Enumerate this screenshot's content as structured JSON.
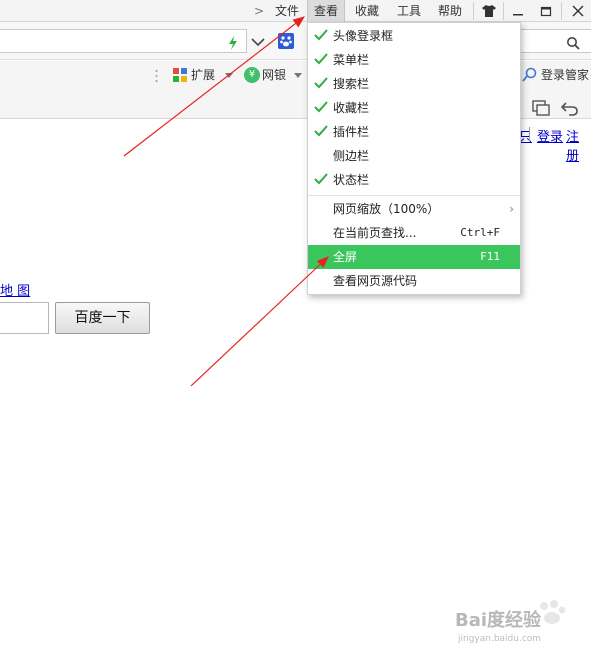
{
  "menubar": {
    "items": [
      "文件",
      "查看",
      "收藏",
      "工具",
      "帮助"
    ],
    "active_index": 1
  },
  "window_controls": {
    "skin_icon": "tshirt-icon",
    "minimize_icon": "minimize-icon",
    "restore_icon": "restore-icon",
    "close_icon": "close-icon"
  },
  "address_bar": {
    "value": "",
    "bolt_icon": "lightning-icon",
    "dropdown_icon": "chevron-down-icon",
    "engine_icon": "baidu-paw-icon",
    "search_icon": "search-icon"
  },
  "toolbar": {
    "extensions_label": "扩展",
    "bank_label": "网银",
    "login_manager_label": "登录管家"
  },
  "page": {
    "top_link_partial": "只",
    "login_link": "登录",
    "register_link": "注册",
    "map_link": "地 图",
    "search_button": "百度一下"
  },
  "dropdown": {
    "items": [
      {
        "label": "头像登录框",
        "checked": true
      },
      {
        "label": "菜单栏",
        "checked": true
      },
      {
        "label": "搜索栏",
        "checked": true
      },
      {
        "label": "收藏栏",
        "checked": true
      },
      {
        "label": "插件栏",
        "checked": true
      },
      {
        "label": "侧边栏",
        "checked": false
      },
      {
        "label": "状态栏",
        "checked": true
      }
    ],
    "zoom_label": "网页缩放（100%）",
    "find_label": "在当前页查找...",
    "find_shortcut": "Ctrl+F",
    "fullscreen_label": "全屏",
    "fullscreen_shortcut": "F11",
    "view_source_label": "查看网页源代码",
    "highlight_color": "#3ac55d"
  },
  "annotations": {
    "arrow_color": "#e8231f"
  },
  "watermark": {
    "brand": "Bai度经验",
    "url": "jingyan.baidu.com"
  }
}
